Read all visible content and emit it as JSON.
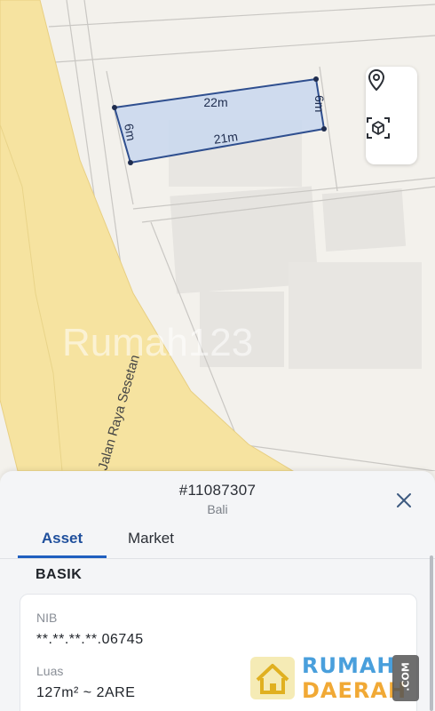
{
  "map": {
    "street_name": "Jalan Raya Sesetan",
    "dim_top": "22m",
    "dim_bottom": "21m",
    "dim_left": "6m",
    "dim_right": "6m",
    "watermark": "Rumah123"
  },
  "map_controls": [
    {
      "icon": "location-pin-icon"
    },
    {
      "icon": "3d-box-icon"
    }
  ],
  "sheet": {
    "asset_id": "#11087307",
    "region": "Bali",
    "tabs": [
      {
        "label": "Asset",
        "active": true
      },
      {
        "label": "Market",
        "active": false
      }
    ],
    "section_title": "BASIK",
    "fields": [
      {
        "label": "NIB",
        "value": "**.**.**.**.06745"
      },
      {
        "label": "Luas",
        "value": "127m² ~ 2ARE"
      }
    ]
  },
  "watermark_logo": {
    "line1": "RUMAH",
    "line2": "DAERAH",
    "suffix": ".COM",
    "colors": {
      "blue": "#2a8fd6",
      "orange": "#f0a020"
    }
  },
  "colors": {
    "road": "#f6e3a0",
    "parcel_fill": "#c8d7ef",
    "parcel_stroke": "#2f4f8f",
    "accent": "#1f5fbf"
  }
}
